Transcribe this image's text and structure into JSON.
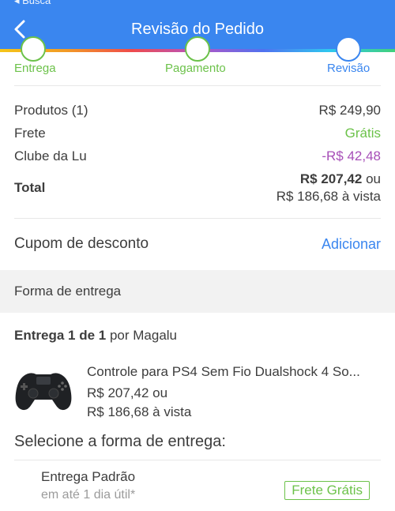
{
  "status": {
    "back_label": "◂ Busca"
  },
  "header": {
    "title": "Revisão do Pedido",
    "back_icon": "chevron-left-icon"
  },
  "steps": [
    {
      "label": "Entrega",
      "state": "done"
    },
    {
      "label": "Pagamento",
      "state": "done"
    },
    {
      "label": "Revisão",
      "state": "current"
    }
  ],
  "summary": {
    "produtos_label": "Produtos (1)",
    "produtos_value": "R$ 249,90",
    "frete_label": "Frete",
    "frete_value": "Grátis",
    "clube_label": "Clube da Lu",
    "clube_value": "-R$ 42,48",
    "total_label": "Total",
    "total_value": "R$ 207,42",
    "total_or": "ou",
    "total_vista": "R$ 186,68 à vista"
  },
  "coupon": {
    "label": "Cupom de desconto",
    "action": "Adicionar"
  },
  "section": {
    "title": "Forma de entrega"
  },
  "delivery": {
    "prefix": "Entrega 1 de 1",
    "by": "por Magalu"
  },
  "product": {
    "name": "Controle para PS4 Sem Fio Dualshock 4 So...",
    "price_line1": "R$ 207,42 ou",
    "price_line2": "R$ 186,68 à vista",
    "image_icon": "gamepad-icon"
  },
  "shipping": {
    "select_title": "Selecione a forma de entrega:",
    "option_title": "Entrega Padrão",
    "option_sub": "em até 1 dia útil*",
    "badge": "Frete Grátis"
  },
  "colors": {
    "primary": "#3a86ef",
    "green": "#6cc24a",
    "purple": "#a74fb8",
    "section_bg": "#f2f2f2"
  }
}
